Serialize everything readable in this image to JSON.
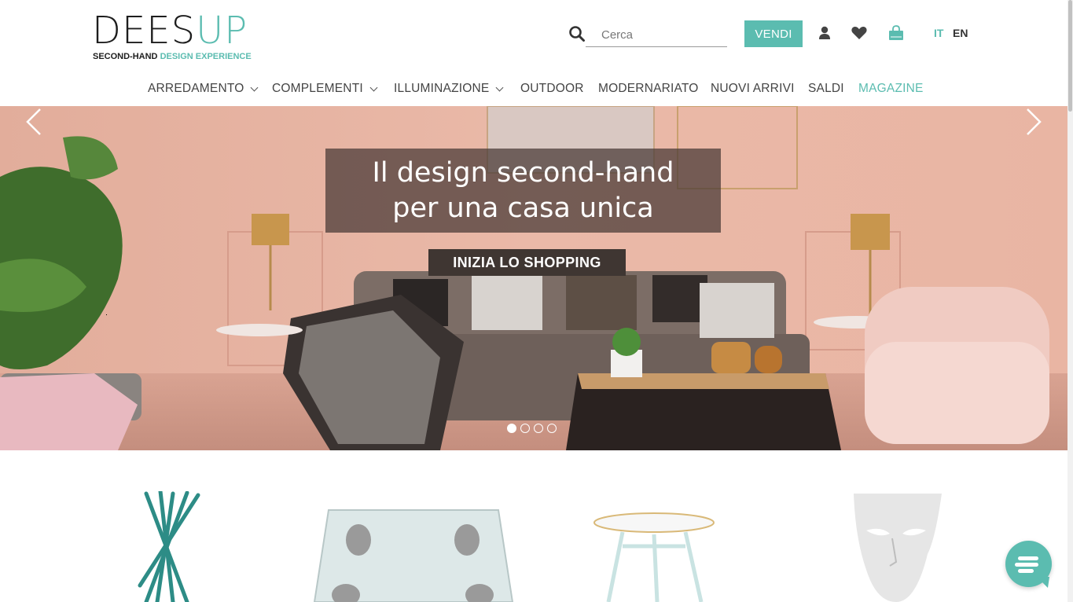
{
  "logo": {
    "mark_part1": "DE",
    "mark_part2": "E",
    "mark_part3": "S",
    "mark_part4": "UP",
    "tag_part1": "SECOND-HAND ",
    "tag_part2": "DESIGN EXPERIENCE"
  },
  "header": {
    "search_placeholder": "Cerca",
    "sell_label": "VENDI",
    "lang_it": "IT",
    "lang_en": "EN"
  },
  "nav": {
    "items": [
      {
        "label": "ARREDAMENTO"
      },
      {
        "label": "COMPLEMENTI"
      },
      {
        "label": "ILLUMINAZIONE"
      },
      {
        "label": "OUTDOOR"
      },
      {
        "label": "MODERNARIATO"
      },
      {
        "label": "NUOVI ARRIVI"
      },
      {
        "label": "SALDI"
      },
      {
        "label": "MAGAZINE"
      }
    ]
  },
  "hero": {
    "headline_line1": "Il design second-hand",
    "headline_line2": "per una casa unica",
    "cta_label": "INIZIA LO SHOPPING",
    "slide_count": 4,
    "active_slide": 1
  },
  "colors": {
    "accent": "#5bbcb0",
    "text": "#333333",
    "hero_wall": "#e7b6a5"
  },
  "icons": [
    "search-icon",
    "user-icon",
    "heart-icon",
    "shopping-bag-icon",
    "chevron-left-icon",
    "chevron-right-icon",
    "chat-icon"
  ]
}
